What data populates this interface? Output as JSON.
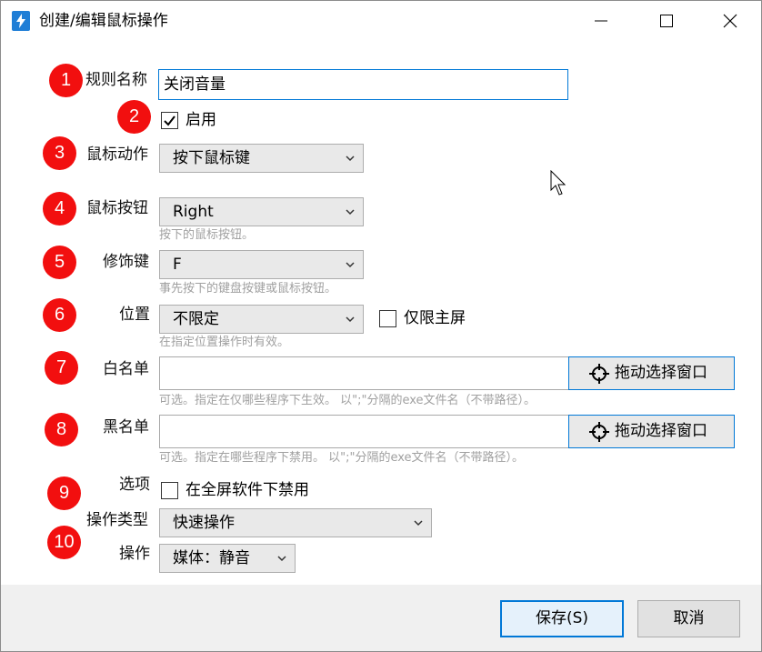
{
  "window": {
    "title": "创建/编辑鼠标操作"
  },
  "badges": [
    "1",
    "2",
    "3",
    "4",
    "5",
    "6",
    "7",
    "8",
    "9",
    "10"
  ],
  "rule_name": {
    "label": "规则名称",
    "value": "关闭音量"
  },
  "enabled": {
    "label": "启用",
    "checked": true
  },
  "mouse_action": {
    "label": "鼠标动作",
    "value": "按下鼠标键"
  },
  "mouse_button": {
    "label": "鼠标按钮",
    "value": "Right",
    "hint": "按下的鼠标按钮。"
  },
  "modifier": {
    "label": "修饰键",
    "value": "F",
    "hint": "事先按下的键盘按键或鼠标按钮。"
  },
  "position": {
    "label": "位置",
    "value": "不限定",
    "primary_only_label": "仅限主屏",
    "primary_only_checked": false,
    "hint": "在指定位置操作时有效。"
  },
  "whitelist": {
    "label": "白名单",
    "value": "",
    "pick_button": "拖动选择窗口",
    "hint": "可选。指定在仅哪些程序下生效。 以\";\"分隔的exe文件名（不带路径）。"
  },
  "blacklist": {
    "label": "黑名单",
    "value": "",
    "pick_button": "拖动选择窗口",
    "hint": "可选。指定在哪些程序下禁用。 以\";\"分隔的exe文件名（不带路径）。"
  },
  "options": {
    "label": "选项",
    "fullscreen_label": "在全屏软件下禁用",
    "fullscreen_checked": false
  },
  "operation_type": {
    "label": "操作类型",
    "value": "快速操作"
  },
  "operation": {
    "label": "操作",
    "value": "媒体：静音"
  },
  "footer": {
    "save": "保存(S)",
    "cancel": "取消"
  },
  "colors": {
    "accent": "#0078d7",
    "badge": "#f20f0f"
  }
}
